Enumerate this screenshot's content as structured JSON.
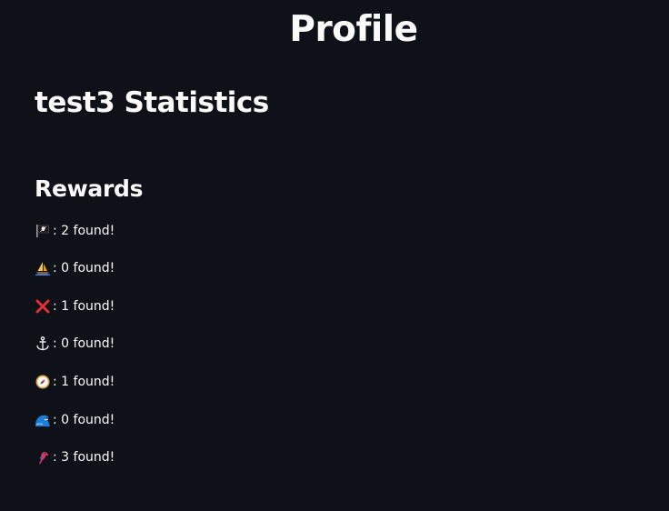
{
  "page": {
    "title": "Profile",
    "stats_heading": "test3 Statistics"
  },
  "rewards": {
    "heading": "Rewards",
    "items": [
      {
        "icon": "pirate-flag-icon",
        "text": ": 2 found!"
      },
      {
        "icon": "sailboat-icon",
        "text": ": 0 found!"
      },
      {
        "icon": "cross-mark-icon",
        "text": ": 1 found!"
      },
      {
        "icon": "anchor-icon",
        "text": ": 0 found!"
      },
      {
        "icon": "compass-icon",
        "text": ": 1 found!"
      },
      {
        "icon": "wave-icon",
        "text": ": 0 found!"
      },
      {
        "icon": "parrot-icon",
        "text": ": 3 found!"
      }
    ]
  },
  "colors": {
    "background": "#0e1117",
    "text": "#fafafa"
  }
}
